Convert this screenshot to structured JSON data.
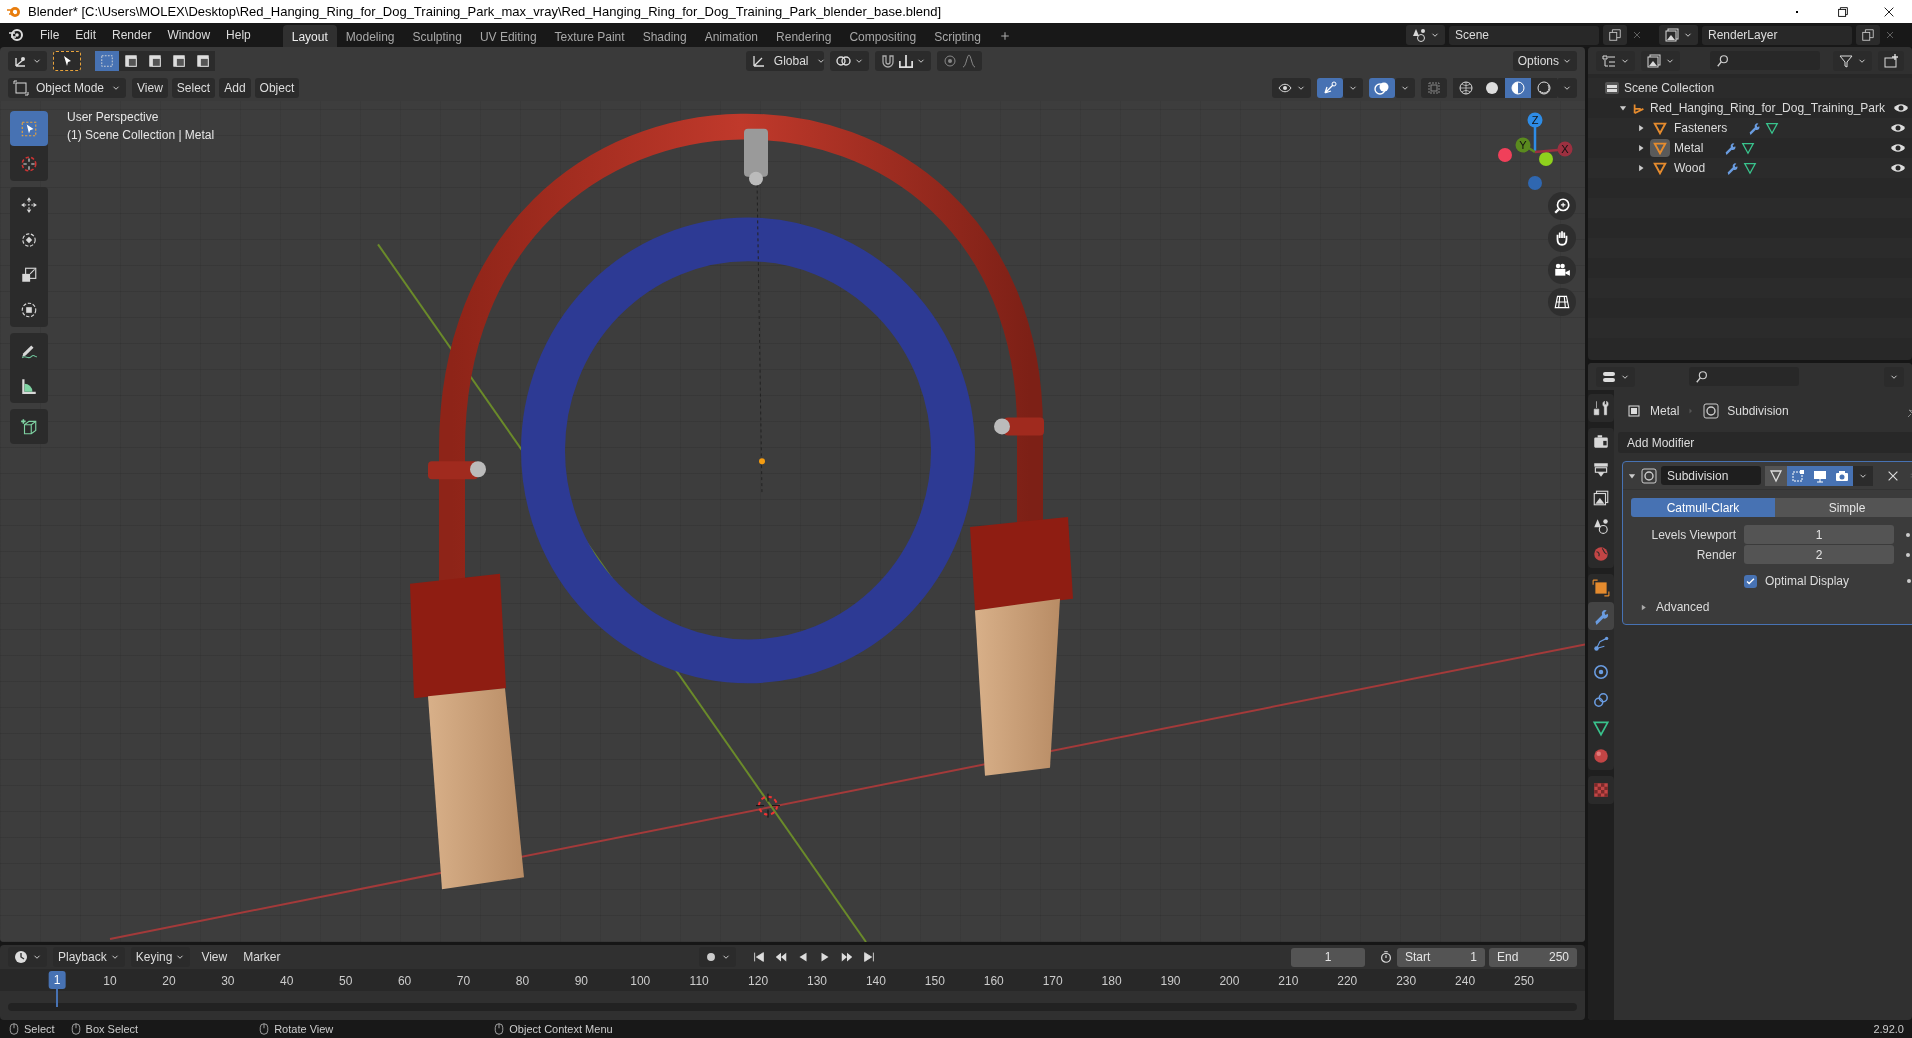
{
  "window": {
    "title": "Blender* [C:\\Users\\MOLEX\\Desktop\\Red_Hanging_Ring_for_Dog_Training_Park_max_vray\\Red_Hanging_Ring_for_Dog_Training_Park_blender_base.blend]"
  },
  "menu_bar": [
    "File",
    "Edit",
    "Render",
    "Window",
    "Help"
  ],
  "workspace_tabs": [
    {
      "label": "Layout",
      "selected": true
    },
    {
      "label": "Modeling",
      "selected": false
    },
    {
      "label": "Sculpting",
      "selected": false
    },
    {
      "label": "UV Editing",
      "selected": false
    },
    {
      "label": "Texture Paint",
      "selected": false
    },
    {
      "label": "Shading",
      "selected": false
    },
    {
      "label": "Animation",
      "selected": false
    },
    {
      "label": "Rendering",
      "selected": false
    },
    {
      "label": "Compositing",
      "selected": false
    },
    {
      "label": "Scripting",
      "selected": false
    }
  ],
  "scene": "Scene",
  "view_layer": "RenderLayer",
  "viewport": {
    "select_modes": [
      {
        "selected": true
      },
      {
        "selected": false
      },
      {
        "selected": false
      },
      {
        "selected": false
      },
      {
        "selected": false
      }
    ],
    "orientation": "Global",
    "options": "Options",
    "mode": "Object Mode",
    "menus": [
      "View",
      "Select",
      "Add",
      "Object"
    ],
    "toggles": [
      {
        "kind": "gizmos",
        "on": true
      },
      {
        "kind": "overlays",
        "on": true
      },
      {
        "kind": "xray",
        "on": false
      }
    ],
    "shading": [
      {
        "kind": "wireframe",
        "selected": false
      },
      {
        "kind": "solid",
        "selected": false
      },
      {
        "kind": "material",
        "selected": true
      },
      {
        "kind": "rendered",
        "selected": false
      }
    ],
    "info": [
      "User Perspective",
      "(1) Scene Collection | Metal"
    ],
    "toolbar": [
      [
        {
          "kind": "select_box",
          "selected": true
        },
        {
          "kind": "cursor",
          "selected": false
        }
      ],
      [
        {
          "kind": "move",
          "selected": false
        },
        {
          "kind": "rotate",
          "selected": false
        },
        {
          "kind": "scale",
          "selected": false
        },
        {
          "kind": "transform",
          "selected": false
        }
      ],
      [
        {
          "kind": "annotate",
          "selected": false
        },
        {
          "kind": "measure",
          "selected": false
        }
      ],
      [
        {
          "kind": "add_cube",
          "selected": false
        }
      ]
    ],
    "gizmo_axes": [
      {
        "kind": "z",
        "label": "Z"
      },
      {
        "kind": "y",
        "label": "Y"
      },
      {
        "kind": "x",
        "label": "X"
      }
    ]
  },
  "outliner": {
    "root": "Scene Collection",
    "items": [
      {
        "label": "Red_Hanging_Ring_for_Dog_Training_Park",
        "kind": "empty",
        "expanded": true,
        "selected": false,
        "children": [
          {
            "label": "Fasteners",
            "kind": "mesh",
            "expanded": false,
            "selected": false
          },
          {
            "label": "Metal",
            "kind": "mesh",
            "expanded": false,
            "selected": true
          },
          {
            "label": "Wood",
            "kind": "mesh",
            "expanded": false,
            "selected": false
          }
        ]
      }
    ]
  },
  "properties": {
    "tabs": [
      [
        {
          "kind": "tool",
          "selected": false
        }
      ],
      [
        {
          "kind": "render",
          "selected": false
        },
        {
          "kind": "output",
          "selected": false
        },
        {
          "kind": "view_layer",
          "selected": false
        },
        {
          "kind": "scene",
          "selected": false
        },
        {
          "kind": "world",
          "selected": false
        }
      ],
      [
        {
          "kind": "object",
          "selected": false
        },
        {
          "kind": "modifier",
          "selected": true
        },
        {
          "kind": "particles",
          "selected": false
        },
        {
          "kind": "physics",
          "selected": false
        },
        {
          "kind": "constraints",
          "selected": false
        },
        {
          "kind": "data",
          "selected": false
        },
        {
          "kind": "material",
          "selected": false
        }
      ],
      [
        {
          "kind": "texture",
          "selected": false
        }
      ]
    ],
    "breadcrumb": [
      "Metal",
      "Subdivision"
    ],
    "add_modifier": "Add Modifier",
    "modifier": {
      "name": "Subdivision",
      "expanded": true,
      "toggles": [
        {
          "kind": "on_cage",
          "on": false
        },
        {
          "kind": "edit_mode",
          "on": true
        },
        {
          "kind": "viewport",
          "on": true
        },
        {
          "kind": "render",
          "on": true
        }
      ],
      "types": [
        {
          "label": "Catmull-Clark",
          "selected": true
        },
        {
          "label": "Simple",
          "selected": false
        }
      ],
      "fields": [
        {
          "label": "Levels Viewport",
          "value": "1"
        },
        {
          "label": "Render",
          "value": "2"
        }
      ],
      "optimal_display": {
        "label": "Optimal Display",
        "checked": true
      },
      "advanced": {
        "label": "Advanced",
        "expanded": false
      }
    }
  },
  "timeline": {
    "menus": [
      "Playback",
      "Keying",
      "View",
      "Marker"
    ],
    "current_frame": "1",
    "start": {
      "label": "Start",
      "value": "1"
    },
    "end": {
      "label": "End",
      "value": "250"
    },
    "playhead": "1",
    "ruler": [
      "10",
      "20",
      "30",
      "40",
      "50",
      "60",
      "70",
      "80",
      "90",
      "100",
      "110",
      "120",
      "130",
      "140",
      "150",
      "160",
      "170",
      "180",
      "190",
      "200",
      "210",
      "220",
      "230",
      "240",
      "250"
    ]
  },
  "status_bar": {
    "items": [
      "Select",
      "Box Select",
      "Rotate View",
      "Object Context Menu"
    ],
    "version": "2.92.0"
  }
}
